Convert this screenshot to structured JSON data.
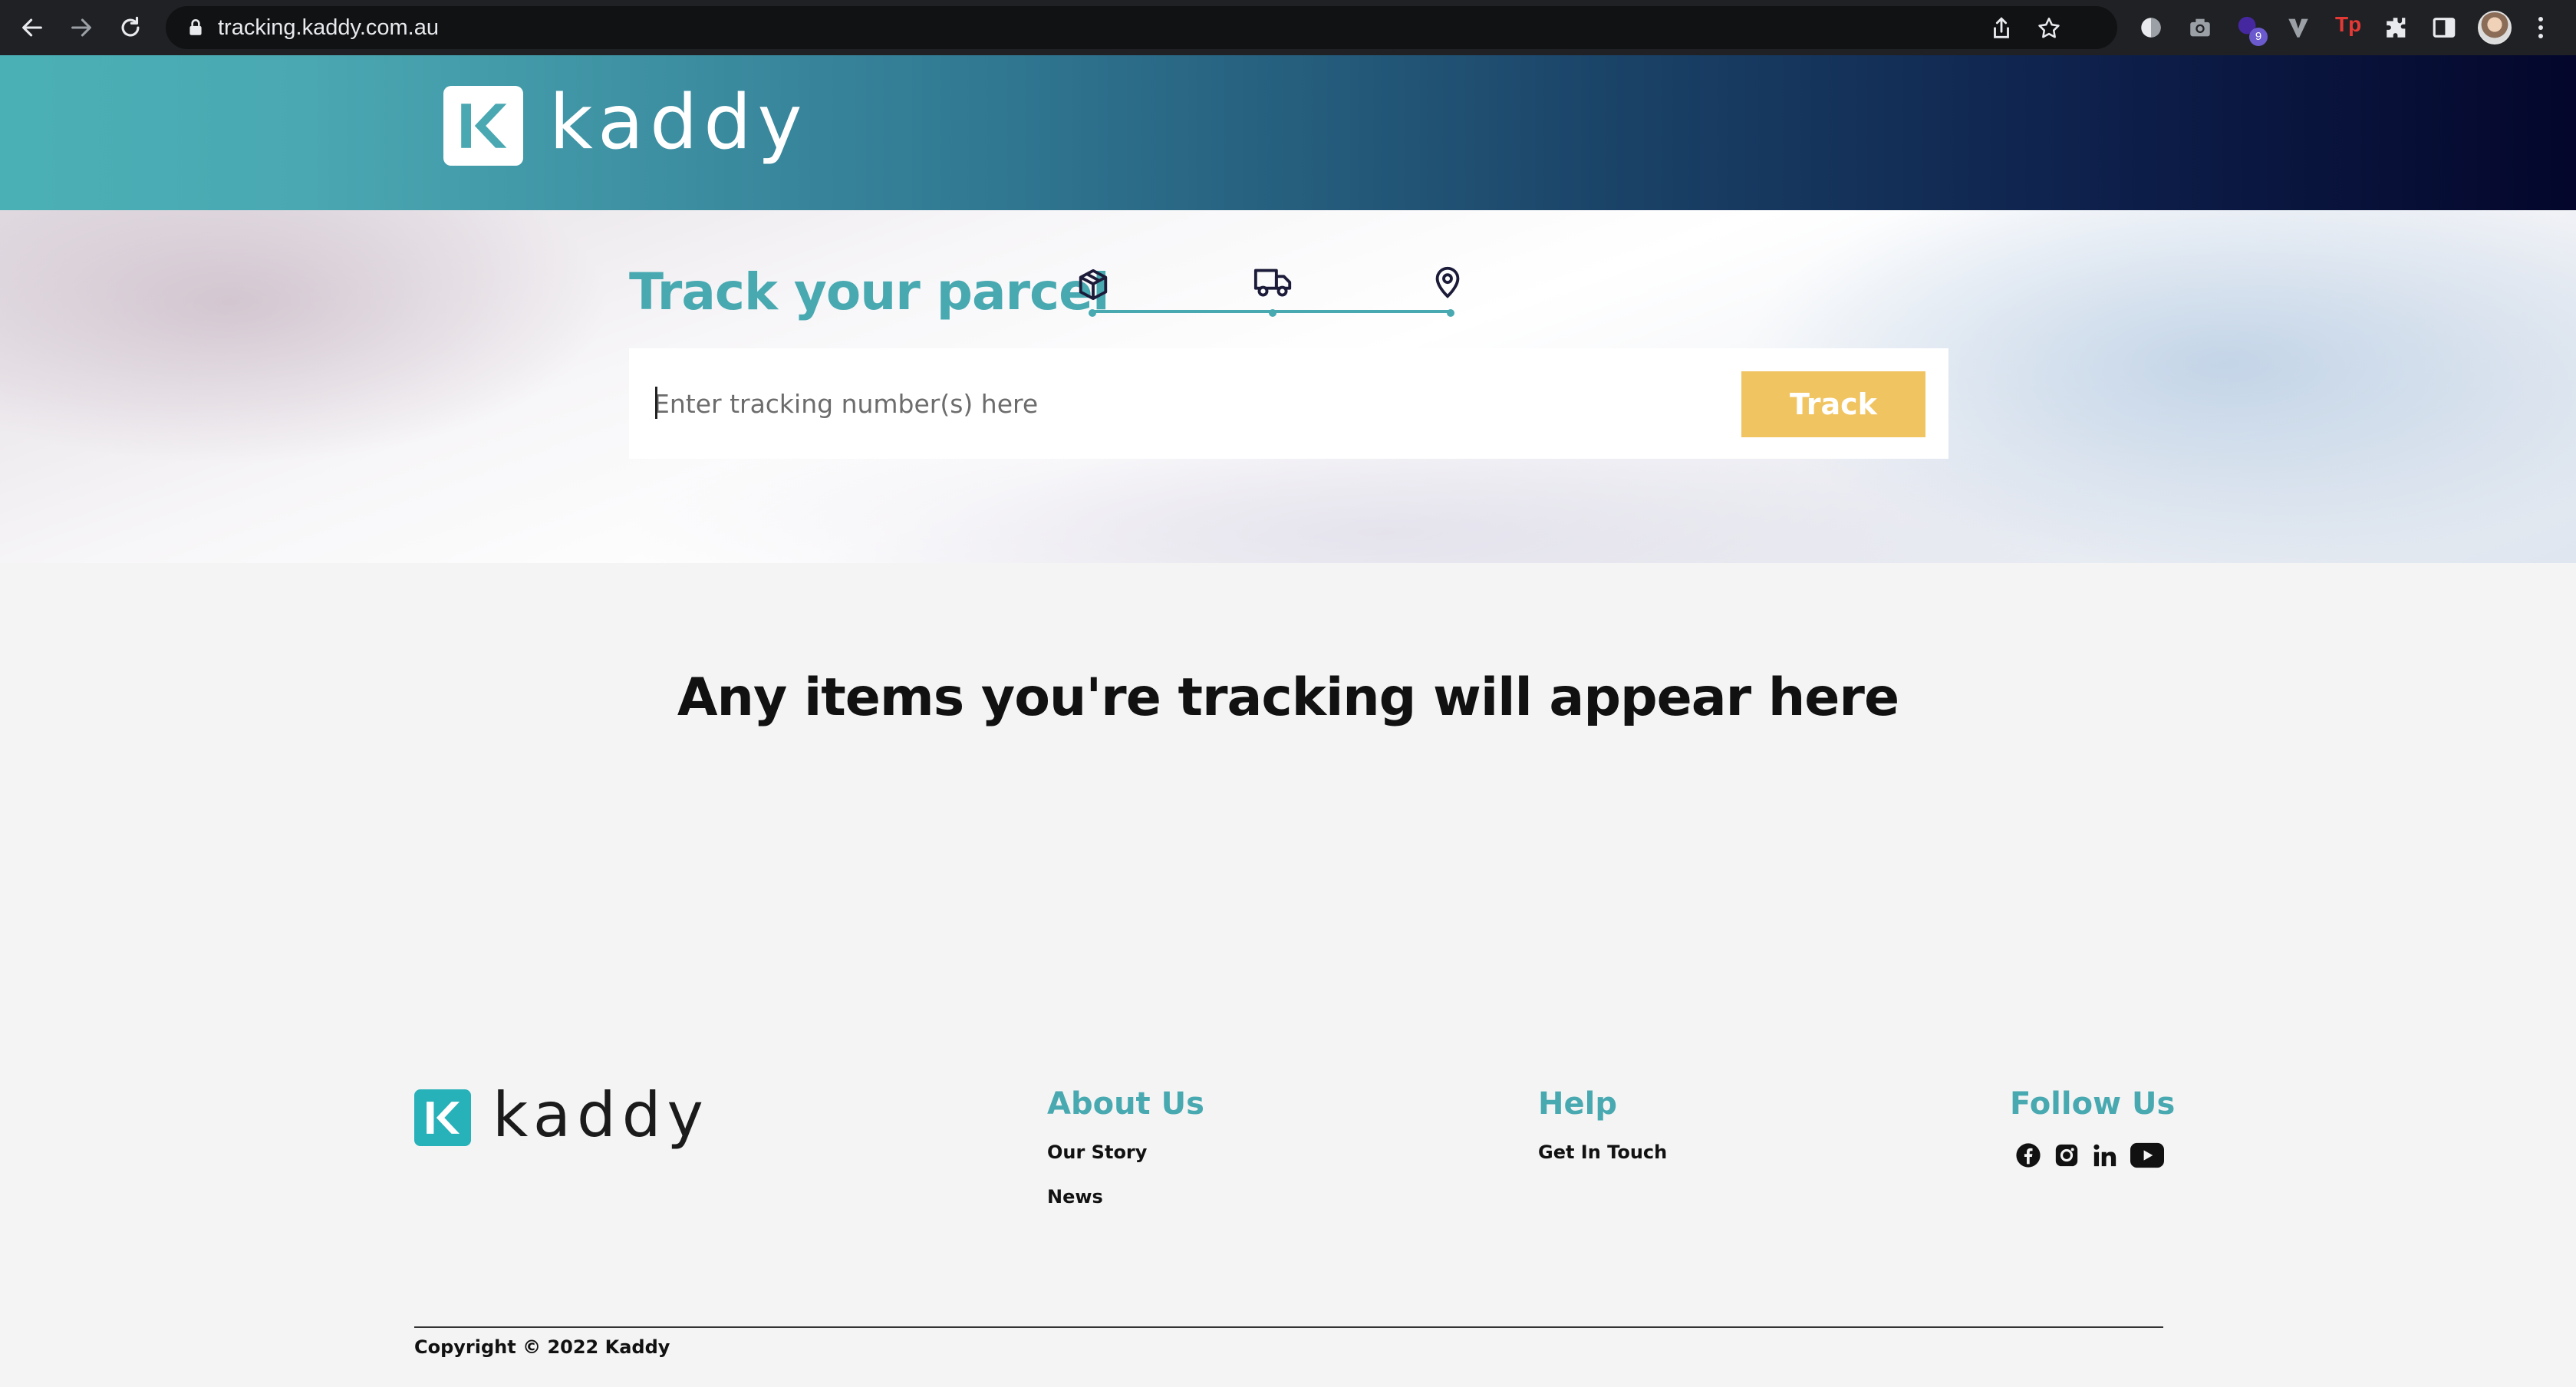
{
  "browser": {
    "url": "tracking.kaddy.com.au",
    "extension_badge": "9",
    "extension_tp": "Tp"
  },
  "header": {
    "brand": "kaddy"
  },
  "hero": {
    "title": "Track your parcel",
    "steps": [
      "package-icon",
      "truck-icon",
      "location-pin-icon"
    ],
    "search_placeholder": "Enter tracking number(s) here",
    "track_button": "Track"
  },
  "main": {
    "empty_message": "Any items you're tracking will appear here"
  },
  "footer": {
    "brand": "kaddy",
    "about": {
      "heading": "About Us",
      "links": [
        "Our Story",
        "News"
      ]
    },
    "help": {
      "heading": "Help",
      "links": [
        "Get In Touch"
      ]
    },
    "follow": {
      "heading": "Follow Us",
      "icons": [
        "facebook-icon",
        "instagram-icon",
        "linkedin-icon",
        "youtube-icon"
      ]
    },
    "copyright": "Copyright © 2022 Kaddy"
  },
  "colors": {
    "brand_teal": "#48a9b1",
    "track_button": "#f1c462",
    "header_dark": "#04062b"
  }
}
